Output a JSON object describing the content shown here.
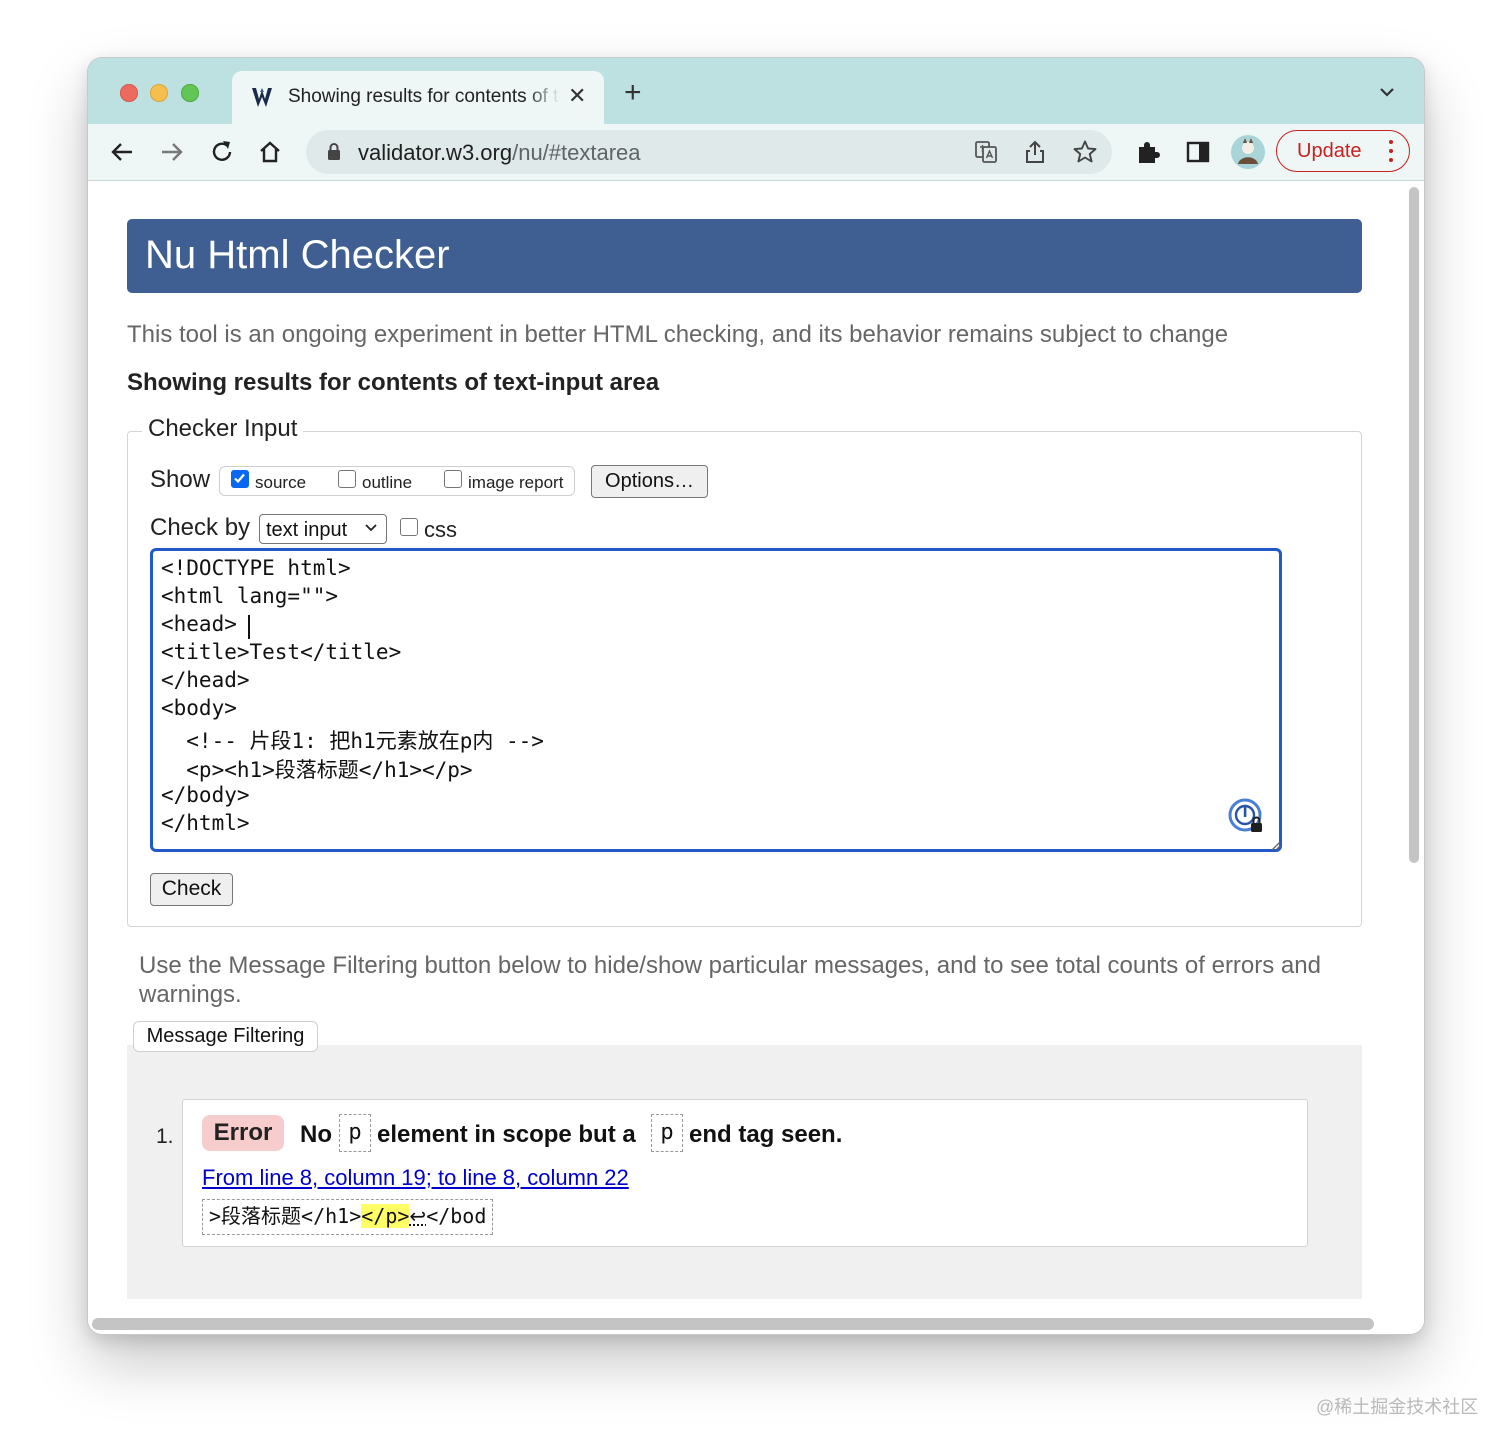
{
  "browser": {
    "tab_title": "Showing results for contents of text-input area",
    "tab_close_glyph": "✕",
    "new_tab_glyph": "+",
    "url_host": "validator.w3.org",
    "url_path": "/nu/#textarea",
    "update_label": "Update",
    "accent": "#c5221f",
    "frame_color": "#bde0e0"
  },
  "page": {
    "title": "Nu Html Checker",
    "intro": "This tool is an ongoing experiment in better HTML checking, and its behavior remains subject to change",
    "results_heading": "Showing results for contents of text-input area",
    "banner_color": "#3f5e92"
  },
  "checker": {
    "legend": "Checker Input",
    "show_label": "Show",
    "show_options": [
      {
        "label": "source",
        "checked": true
      },
      {
        "label": "outline",
        "checked": false
      },
      {
        "label": "image report",
        "checked": false
      }
    ],
    "options_button": "Options…",
    "check_by_label": "Check by",
    "check_by_value": "text input",
    "css_label": "css",
    "css_checked": false,
    "source_lines": [
      "<!DOCTYPE html>",
      "<html lang=\"\">",
      "<head>",
      "<title>Test</title>",
      "</head>",
      "<body>",
      "  <!-- 片段1: 把h1元素放在p内 -->",
      "  <p><h1>段落标题</h1></p>",
      "</body>",
      "</html>"
    ],
    "check_button": "Check"
  },
  "filtering": {
    "note": "Use the Message Filtering button below to hide/show particular messages, and to see total counts of errors and warnings.",
    "button": "Message Filtering"
  },
  "messages": [
    {
      "number": "1.",
      "type": "Error",
      "text_1": "No",
      "code_1": "p",
      "text_2": "element in scope but a",
      "code_2": "p",
      "text_3": "end tag seen.",
      "location": "From line 8, column 19; to line 8, column 22",
      "extract_before": ">段落标题</h1>",
      "extract_highlight": "</p>",
      "extract_linefeed": "↩",
      "extract_after": "</bod"
    }
  ],
  "watermark": "@稀土掘金技术社区"
}
